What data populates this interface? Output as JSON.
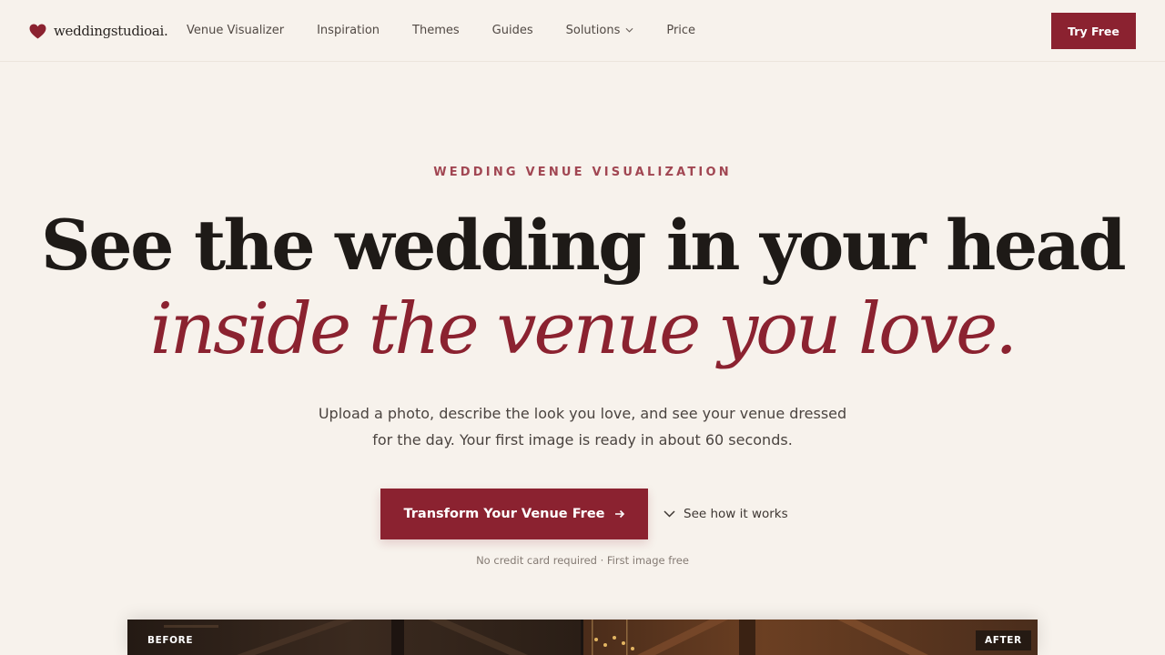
{
  "brand": {
    "name": "weddingstudioai.",
    "accent_color": "#8b2230",
    "icon": "heart-icon"
  },
  "nav": {
    "items": [
      {
        "label": "Venue Visualizer"
      },
      {
        "label": "Inspiration"
      },
      {
        "label": "Themes"
      },
      {
        "label": "Guides"
      },
      {
        "label": "Solutions",
        "has_dropdown": true
      },
      {
        "label": "Price"
      }
    ],
    "cta_label": "Try Free"
  },
  "hero": {
    "eyebrow": "WEDDING VENUE VISUALIZATION",
    "headline": "See the wedding in your head",
    "headline_accent": "inside the venue you love.",
    "subtext": "Upload a photo, describe the look you love, and see your venue dressed for the day. Your first image is ready in about 60 seconds.",
    "primary_cta": "Transform Your Venue Free",
    "secondary_cta": "See how it works",
    "fineprint": "No credit card required · First image free"
  },
  "comparison": {
    "before_label": "BEFORE",
    "after_label": "AFTER"
  }
}
